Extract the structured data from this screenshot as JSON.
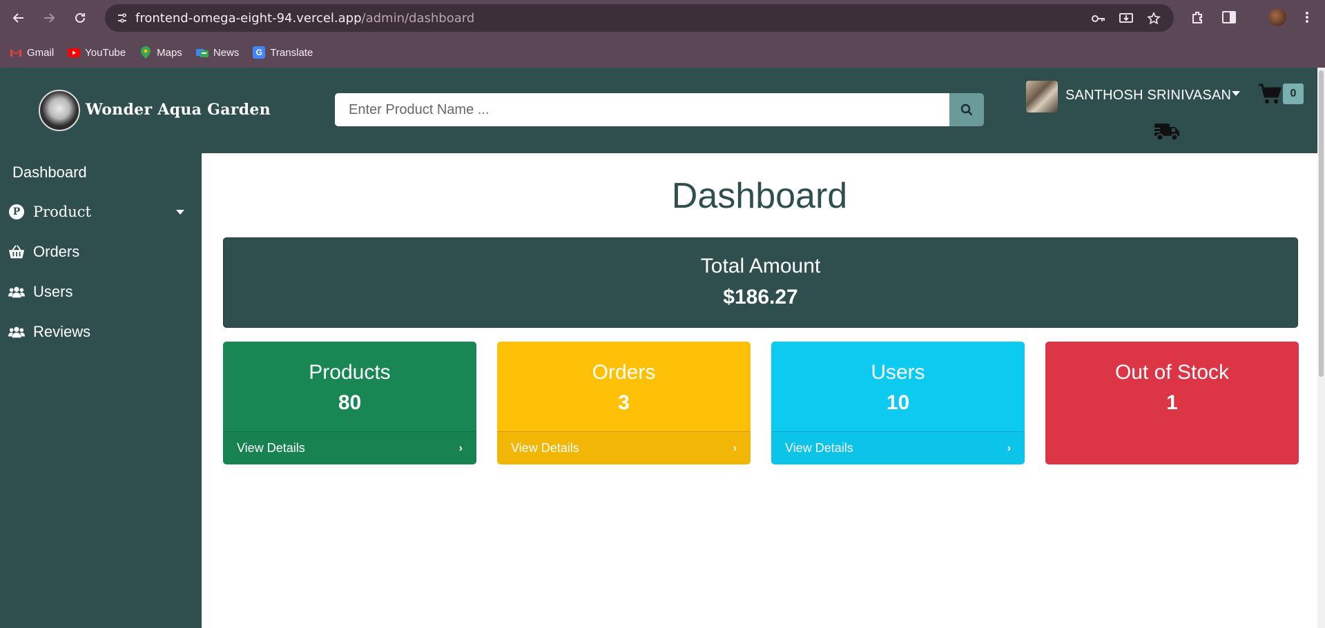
{
  "browser": {
    "url_host": "frontend-omega-eight-94.vercel.app",
    "url_path": "/admin/dashboard",
    "bookmarks": [
      {
        "label": "Gmail",
        "icon": "gmail-icon"
      },
      {
        "label": "YouTube",
        "icon": "youtube-icon"
      },
      {
        "label": "Maps",
        "icon": "maps-icon"
      },
      {
        "label": "News",
        "icon": "news-icon"
      },
      {
        "label": "Translate",
        "icon": "translate-icon"
      }
    ]
  },
  "header": {
    "brand": "Wonder Aqua Garden",
    "search_placeholder": "Enter Product Name ...",
    "user_name": "SANTHOSH SRINIVASAN",
    "cart_count": "0"
  },
  "sidebar": {
    "items": [
      {
        "label": "Dashboard",
        "icon": ""
      },
      {
        "label": "Product",
        "icon": "product-p-icon"
      },
      {
        "label": "Orders",
        "icon": "basket-icon"
      },
      {
        "label": "Users",
        "icon": "users-icon"
      },
      {
        "label": "Reviews",
        "icon": "users-icon"
      }
    ]
  },
  "main": {
    "title": "Dashboard",
    "total": {
      "label": "Total Amount",
      "value": "$186.27"
    },
    "cards": [
      {
        "label": "Products",
        "value": "80",
        "link": "View Details",
        "color": "#198754"
      },
      {
        "label": "Orders",
        "value": "3",
        "link": "View Details",
        "color": "#ffc107"
      },
      {
        "label": "Users",
        "value": "10",
        "link": "View Details",
        "color": "#0dcaf0"
      },
      {
        "label": "Out of Stock",
        "value": "1",
        "color": "#dc3545"
      }
    ]
  },
  "colors": {
    "theme": "#2f4f4f",
    "chrome": "#5b4756"
  }
}
